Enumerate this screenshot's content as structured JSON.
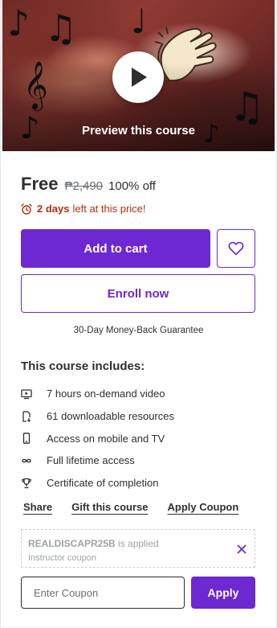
{
  "preview": {
    "label": "Preview this course",
    "icons": [
      "play-icon",
      "music-note-icon",
      "treble-clef-icon",
      "clapping-hands-image"
    ]
  },
  "pricing": {
    "current": "Free",
    "original": "₱2,490",
    "discount": "100% off",
    "timer_bold": "2 days",
    "timer_rest": "left at this price!"
  },
  "actions": {
    "add_to_cart": "Add to cart",
    "wishlist_icon": "heart-icon",
    "enroll": "Enroll now",
    "guarantee": "30-Day Money-Back Guarantee"
  },
  "includes": {
    "title": "This course includes:",
    "items": [
      {
        "icon": "video-icon",
        "label": "7 hours on-demand video"
      },
      {
        "icon": "download-file-icon",
        "label": "61 downloadable resources"
      },
      {
        "icon": "mobile-icon",
        "label": "Access on mobile and TV"
      },
      {
        "icon": "infinity-icon",
        "label": "Full lifetime access"
      },
      {
        "icon": "trophy-icon",
        "label": "Certificate of completion"
      }
    ]
  },
  "links": {
    "share": "Share",
    "gift": "Gift this course",
    "apply_coupon": "Apply Coupon"
  },
  "coupon": {
    "code": "REALDISCAPR25B",
    "applied_text": "is applied",
    "type": "Instructor coupon",
    "input_placeholder": "Enter Coupon",
    "apply_label": "Apply"
  },
  "colors": {
    "brand": "#6d28d2",
    "text": "#2d2f31",
    "alert": "#b32d0f",
    "muted": "#9da3a7"
  }
}
